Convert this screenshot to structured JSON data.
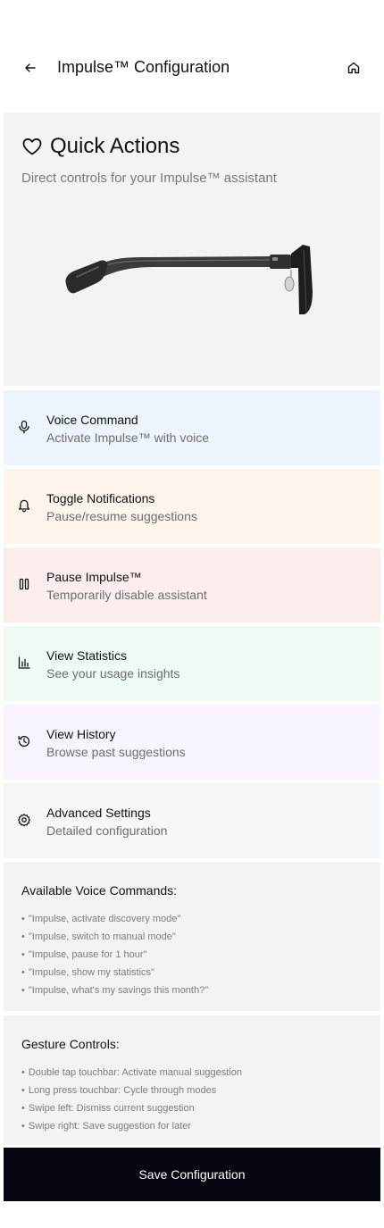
{
  "header": {
    "title": "Impulse™ Configuration",
    "back_icon": "arrow-left-icon",
    "home_icon": "home-icon"
  },
  "quick_actions": {
    "icon": "heart-icon",
    "title": "Quick Actions",
    "subtitle": "Direct controls for your Impulse™ assistant",
    "image": "smart-glasses-side-view"
  },
  "actions": [
    {
      "icon": "microphone-icon",
      "title": "Voice Command",
      "description": "Activate Impulse™ with voice",
      "color": "#eef4fd"
    },
    {
      "icon": "bell-icon",
      "title": "Toggle Notifications",
      "description": "Pause/resume suggestions",
      "color": "#fdf5ec"
    },
    {
      "icon": "pause-icon",
      "title": "Pause Impulse™",
      "description": "Temporarily disable assistant",
      "color": "#fdeeee"
    },
    {
      "icon": "bar-chart-icon",
      "title": "View Statistics",
      "description": "See your usage insights",
      "color": "#effbf2"
    },
    {
      "icon": "history-icon",
      "title": "View History",
      "description": "Browse past suggestions",
      "color": "#f8f3fd"
    },
    {
      "icon": "gear-icon",
      "title": "Advanced Settings",
      "description": "Detailed configuration",
      "color": "#f6f7f9"
    }
  ],
  "voice_commands": {
    "title": "Available Voice Commands:",
    "items": [
      "\"Impulse, activate discovery mode\"",
      "\"Impulse, switch to manual mode\"",
      "\"Impulse, pause for 1 hour\"",
      "\"Impulse, show my statistics\"",
      "\"Impulse, what's my savings this month?\""
    ]
  },
  "gesture_controls": {
    "title": "Gesture Controls:",
    "items": [
      "Double tap touchbar: Activate manual suggestion",
      "Long press touchbar: Cycle through modes",
      "Swipe left: Dismiss current suggestion",
      "Swipe right: Save suggestion for later"
    ]
  },
  "save_button": {
    "label": "Save Configuration"
  }
}
